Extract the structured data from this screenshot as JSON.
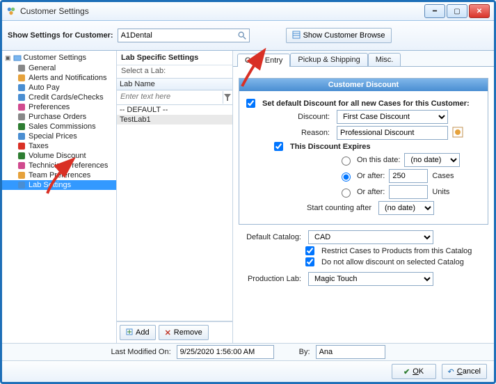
{
  "window": {
    "title": "Customer Settings"
  },
  "toolbar": {
    "showSettingsLabel": "Show Settings for Customer:",
    "customerValue": "A1Dental",
    "browseLabel": "Show Customer Browse"
  },
  "tree": {
    "root": "Customer Settings",
    "items": [
      {
        "label": "General",
        "icon": "gear-icon",
        "color": "#888"
      },
      {
        "label": "Alerts and Notifications",
        "icon": "bell-icon",
        "color": "#e6a23c"
      },
      {
        "label": "Auto Pay",
        "icon": "card-icon",
        "color": "#4a8ed2"
      },
      {
        "label": "Credit Cards/eChecks",
        "icon": "card-icon",
        "color": "#4a8ed2"
      },
      {
        "label": "Preferences",
        "icon": "target-icon",
        "color": "#d04a8e"
      },
      {
        "label": "Purchase Orders",
        "icon": "doc-icon",
        "color": "#888"
      },
      {
        "label": "Sales Commissions",
        "icon": "money-icon",
        "color": "#2e7d32"
      },
      {
        "label": "Special Prices",
        "icon": "price-icon",
        "color": "#4a8ed2"
      },
      {
        "label": "Taxes",
        "icon": "tax-icon",
        "color": "#d93025"
      },
      {
        "label": "Volume Discount",
        "icon": "volume-icon",
        "color": "#2e7d32"
      },
      {
        "label": "Technician Preferences",
        "icon": "user-icon",
        "color": "#d04a8e"
      },
      {
        "label": "Team Preferences",
        "icon": "team-icon",
        "color": "#e6a23c"
      },
      {
        "label": "Lab Settings",
        "icon": "lab-icon",
        "color": "#4a8ed2",
        "selected": true
      }
    ]
  },
  "mid": {
    "heading": "Lab Specific Settings",
    "subheading": "Select a Lab:",
    "columnHeader": "Lab Name",
    "filterPlaceholder": "Enter text here",
    "rows": [
      {
        "label": "-- DEFAULT --",
        "selected": false
      },
      {
        "label": "TestLab1",
        "selected": true
      }
    ],
    "addLabel": "Add",
    "removeLabel": "Remove"
  },
  "tabs": [
    "Case Entry",
    "Pickup & Shipping",
    "Misc."
  ],
  "discount": {
    "groupTitle": "Customer Discount",
    "setDefaultLabel": "Set default Discount for all new Cases for this Customer:",
    "discountLabel": "Discount:",
    "discountValue": "First Case Discount",
    "reasonLabel": "Reason:",
    "reasonValue": "Professional Discount",
    "expiresLabel": "This Discount Expires",
    "onThisDateLabel": "On this date:",
    "orAfterLabel": "Or after:",
    "casesValue": "250",
    "casesUnit": "Cases",
    "unitsUnit": "Units",
    "startCountingLabel": "Start counting after",
    "noDate": "(no date)"
  },
  "catalog": {
    "defaultCatalogLabel": "Default Catalog:",
    "defaultCatalogValue": "CAD",
    "restrictLabel": "Restrict Cases to Products from this Catalog",
    "noDiscountLabel": "Do not allow discount on selected Catalog",
    "productionLabLabel": "Production Lab:",
    "productionLabValue": "Magic Touch"
  },
  "footer": {
    "lastModifiedLabel": "Last Modified On:",
    "lastModifiedValue": "9/25/2020 1:56:00 AM",
    "byLabel": "By:",
    "byValue": "Ana",
    "okAccess": "O",
    "okRest": "K",
    "cancelAccess": "C",
    "cancelRest": "ancel"
  }
}
